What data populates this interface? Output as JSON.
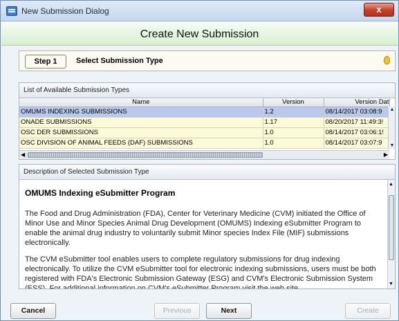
{
  "window": {
    "title": "New Submission Dialog",
    "close_label": "x"
  },
  "header": {
    "title": "Create New Submission"
  },
  "step": {
    "button_label": "Step 1",
    "label": "Select Submission Type"
  },
  "list": {
    "panel_title": "List of Available Submission Types",
    "columns": [
      "Name",
      "Version",
      "Version Dat"
    ],
    "rows": [
      {
        "name": "OMUMS INDEXING SUBMISSIONS",
        "version": "1.2",
        "date": "08/14/2017 03:08:9",
        "selected": true
      },
      {
        "name": "ONADE SUBMISSIONS",
        "version": "1.17",
        "date": "08/20/2017 11:49:3!",
        "selected": false
      },
      {
        "name": "OSC DER SUBMISSIONS",
        "version": "1.0",
        "date": "08/14/2017 03:06:1!",
        "selected": false
      },
      {
        "name": "OSC DIVISION OF ANIMAL FEEDS (DAF) SUBMISSIONS",
        "version": "1.0",
        "date": "08/14/2017 03:07:9",
        "selected": false
      }
    ]
  },
  "description": {
    "panel_title": "Description of Selected Submission Type",
    "heading": "OMUMS Indexing eSubmitter Program",
    "paragraphs": [
      "The Food and Drug Administration (FDA), Center for Veterinary Medicine (CVM) initiated the Office of Minor Use and Minor Species Animal Drug Development (OMUMS) Indexing eSubmitter Program to enable the animal drug industry to voluntarily submit Minor species Index File (MIF) submissions electronically.",
      "The CVM eSubmitter tool enables users to complete regulatory submissions for drug indexing electronically. To utilize the CVM eSubmitter tool for electronic indexing submissions, users must be both registered with FDA's Electronic Submission Gateway (ESG) and CVM's Electronic Submission System (ESS). For additional information on CVM's eSubmitter Program visit the web site."
    ]
  },
  "buttons": {
    "cancel": "Cancel",
    "previous": "Previous",
    "next": "Next",
    "create": "Create"
  }
}
